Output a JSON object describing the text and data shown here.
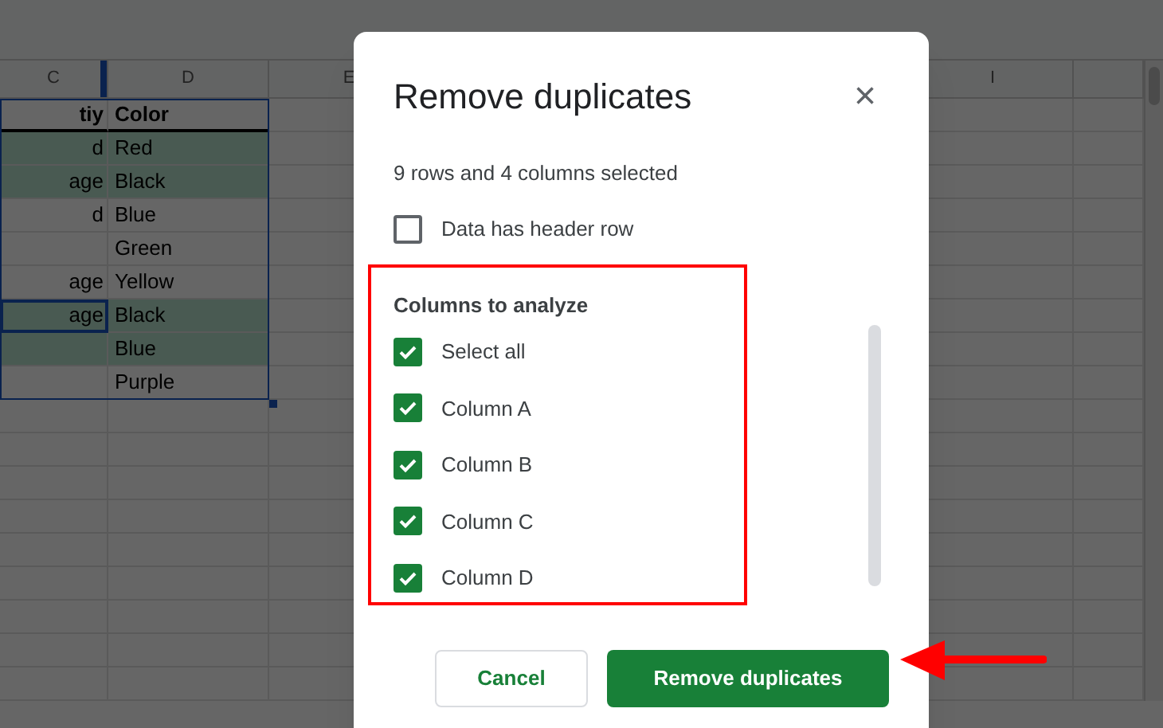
{
  "sheet": {
    "columns": [
      {
        "label": "C"
      },
      {
        "label": "D"
      },
      {
        "label": "E"
      },
      {
        "label": "I"
      }
    ],
    "rows": [
      {
        "c": "tiy",
        "d": "Color",
        "kind": "header",
        "highlighted": false,
        "selected": false
      },
      {
        "c": "d",
        "d": "Red",
        "kind": "data",
        "highlighted": true,
        "selected": false
      },
      {
        "c": "age",
        "d": "Black",
        "kind": "data",
        "highlighted": true,
        "selected": false
      },
      {
        "c": "d",
        "d": "Blue",
        "kind": "data",
        "highlighted": false,
        "selected": false
      },
      {
        "d": "Green",
        "kind": "data",
        "highlighted": false,
        "selected": false
      },
      {
        "c": "age",
        "d": "Yellow",
        "kind": "data",
        "highlighted": false,
        "selected": false
      },
      {
        "c": "age",
        "d": "Black",
        "kind": "data",
        "highlighted": true,
        "selected": true
      },
      {
        "d": "Blue",
        "kind": "data",
        "highlighted": true,
        "selected": false
      },
      {
        "d": "Purple",
        "kind": "data",
        "highlighted": false,
        "selected": false
      }
    ]
  },
  "dialog": {
    "title": "Remove duplicates",
    "close": "×",
    "summary": "9 rows and 4 columns selected",
    "header_option": {
      "label": "Data has header row",
      "checked": false
    },
    "section_title": "Columns to analyze",
    "options": [
      {
        "label": "Select all",
        "checked": true
      },
      {
        "label": "Column A",
        "checked": true
      },
      {
        "label": "Column B",
        "checked": true
      },
      {
        "label": "Column C",
        "checked": true
      },
      {
        "label": "Column D",
        "checked": true
      }
    ],
    "buttons": [
      {
        "label": "Cancel",
        "kind": "secondary"
      },
      {
        "label": "Remove duplicates",
        "kind": "primary"
      }
    ]
  }
}
